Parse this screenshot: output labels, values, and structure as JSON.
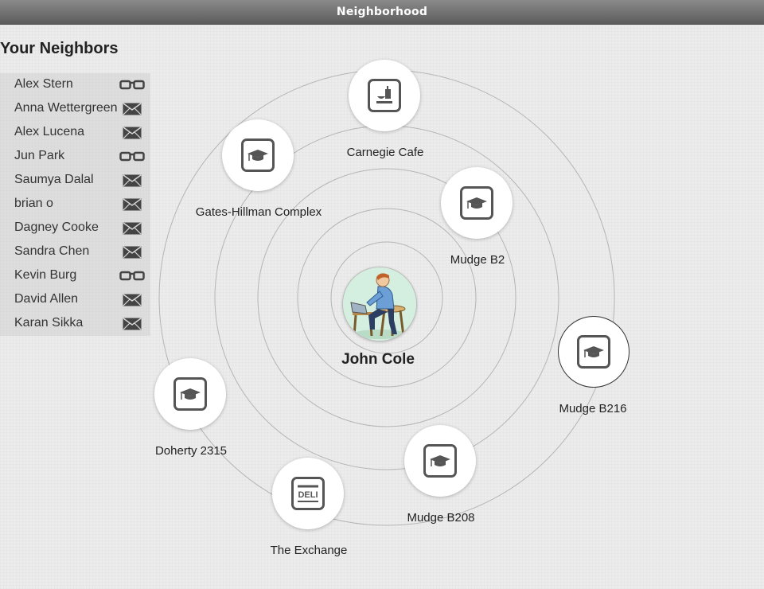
{
  "window": {
    "title": "Neighborhood"
  },
  "sidebar": {
    "title": "Your Neighbors",
    "neighbors": [
      {
        "name": "Alex Stern",
        "icon": "glasses-icon"
      },
      {
        "name": "Anna Wettergreen",
        "icon": "envelope-icon"
      },
      {
        "name": "Alex Lucena",
        "icon": "envelope-icon"
      },
      {
        "name": "Jun Park",
        "icon": "glasses-icon"
      },
      {
        "name": "Saumya Dalal",
        "icon": "envelope-icon"
      },
      {
        "name": "brian o",
        "icon": "envelope-icon"
      },
      {
        "name": "Dagney Cooke",
        "icon": "envelope-icon"
      },
      {
        "name": "Sandra Chen",
        "icon": "envelope-icon"
      },
      {
        "name": "Kevin Burg",
        "icon": "glasses-icon"
      },
      {
        "name": "David Allen",
        "icon": "envelope-icon"
      },
      {
        "name": "Karan Sikka",
        "icon": "envelope-icon"
      }
    ]
  },
  "center": {
    "name": "John Cole",
    "avatar": "user-avatar"
  },
  "places": [
    {
      "label": "Carnegie Cafe",
      "icon": "food-tray-icon"
    },
    {
      "label": "Gates-Hillman Complex",
      "icon": "graduation-cap-icon"
    },
    {
      "label": "Mudge B2",
      "icon": "graduation-cap-icon"
    },
    {
      "label": "Mudge B216",
      "icon": "graduation-cap-icon",
      "selected": true
    },
    {
      "label": "Doherty 2315",
      "icon": "graduation-cap-icon"
    },
    {
      "label": "Mudge B208",
      "icon": "graduation-cap-icon"
    },
    {
      "label": "The Exchange",
      "icon": "deli-icon",
      "icon_text": "DELI"
    }
  ]
}
